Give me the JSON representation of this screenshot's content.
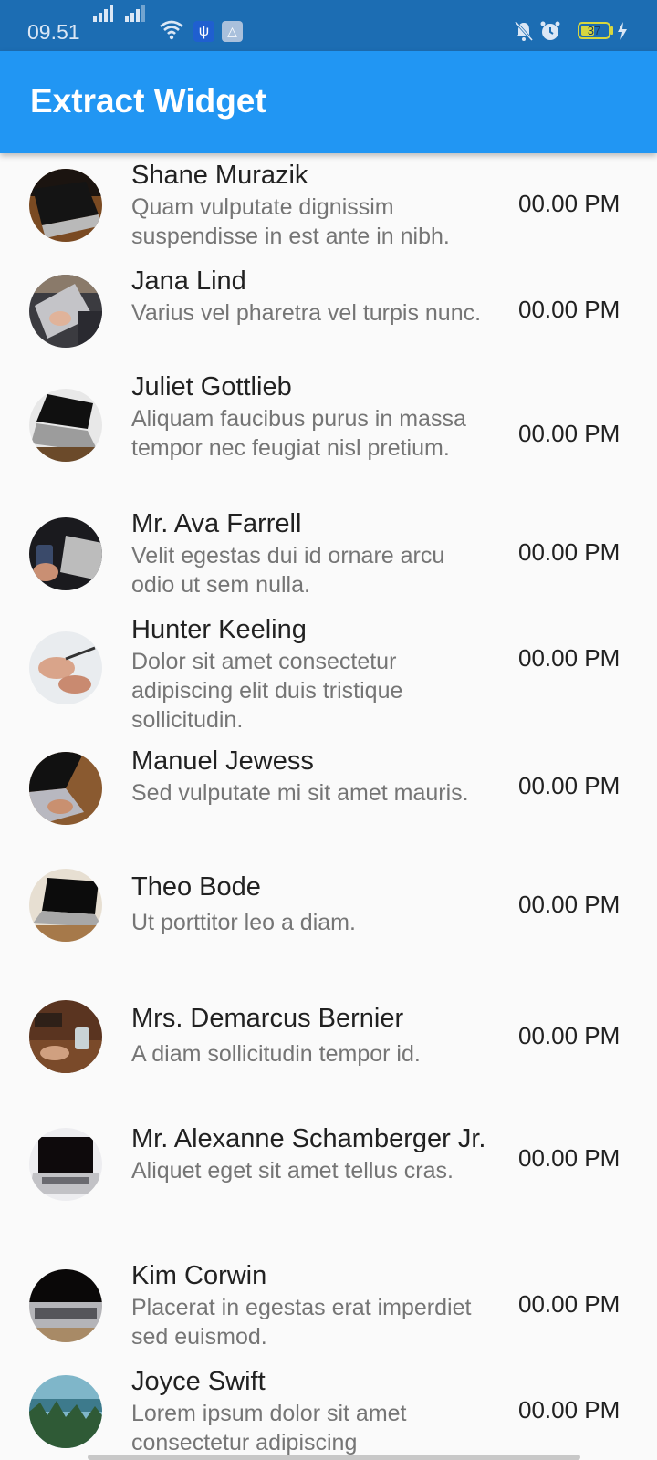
{
  "status_bar": {
    "time": "09.51",
    "battery_level": "37",
    "icons": [
      "signal-icon",
      "signal-icon",
      "wifi-icon",
      "usb-debug-icon",
      "drive-icon",
      "bell-off-icon",
      "alarm-icon",
      "battery-icon",
      "charging-icon"
    ]
  },
  "app_bar": {
    "title": "Extract Widget",
    "color": "#2196f3"
  },
  "list": {
    "items": [
      {
        "title": "Shane Murazik",
        "subtitle": "Quam vulputate dignissim suspendisse in est ante in nibh.",
        "time": "00.00 PM"
      },
      {
        "title": "Jana Lind",
        "subtitle": "Varius vel pharetra vel turpis nunc.",
        "time": "00.00 PM"
      },
      {
        "title": "Juliet Gottlieb",
        "subtitle": "Aliquam faucibus purus in massa tempor nec feugiat nisl pretium.",
        "time": "00.00 PM"
      },
      {
        "title": "Mr. Ava Farrell",
        "subtitle": "Velit egestas dui id ornare arcu odio ut sem nulla.",
        "time": "00.00 PM"
      },
      {
        "title": "Hunter Keeling",
        "subtitle": "Dolor sit amet consectetur adipiscing elit duis tristique sollicitudin.",
        "time": "00.00 PM"
      },
      {
        "title": "Manuel Jewess",
        "subtitle": "Sed vulputate mi sit amet mauris.",
        "time": "00.00 PM"
      },
      {
        "title": "Theo Bode",
        "subtitle": "Ut porttitor leo a diam.",
        "time": "00.00 PM"
      },
      {
        "title": "Mrs. Demarcus Bernier",
        "subtitle": "A diam sollicitudin tempor id.",
        "time": "00.00 PM"
      },
      {
        "title": "Mr. Alexanne Schamberger Jr.",
        "subtitle": "Aliquet eget sit amet tellus cras.",
        "time": "00.00 PM"
      },
      {
        "title": "Kim Corwin",
        "subtitle": "Placerat in egestas erat imperdiet sed euismod.",
        "time": "00.00 PM"
      },
      {
        "title": "Joyce Swift",
        "subtitle": "Lorem ipsum dolor sit amet consectetur adipiscing",
        "time": "00.00 PM"
      }
    ]
  }
}
